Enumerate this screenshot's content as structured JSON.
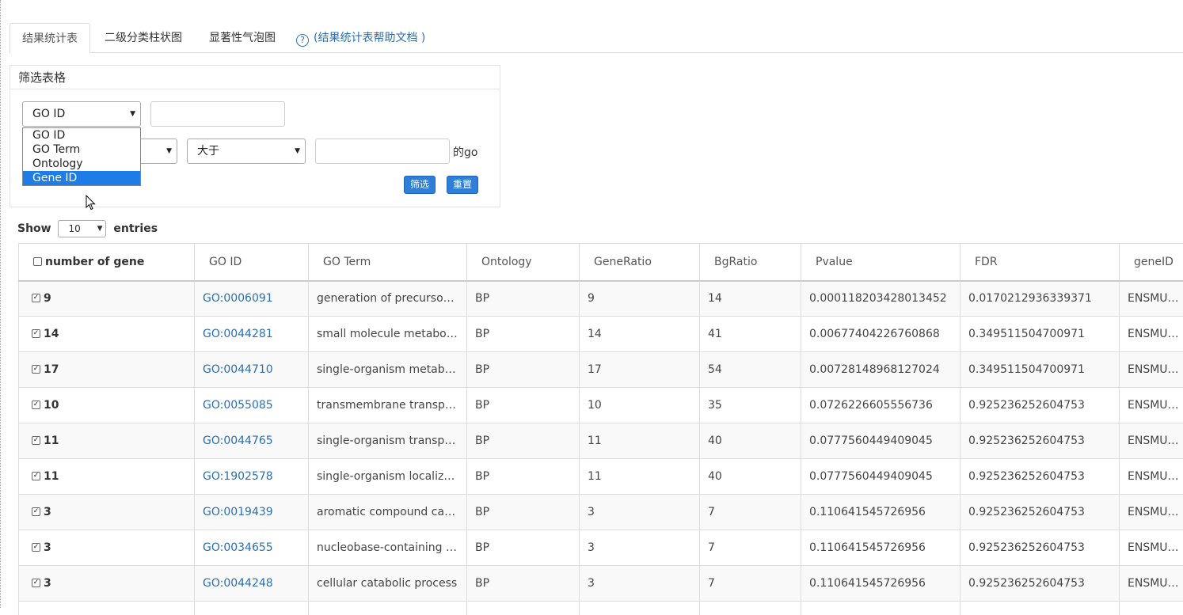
{
  "tabs": [
    {
      "label": "结果统计表",
      "active": true
    },
    {
      "label": "二级分类柱状图",
      "active": false
    },
    {
      "label": "显著性气泡图",
      "active": false
    }
  ],
  "help": {
    "icon": "question-circle-icon",
    "label": "(结果统计表帮助文档 )"
  },
  "filter": {
    "title": "筛选表格",
    "field_select": {
      "value": "GO ID"
    },
    "field_input": {
      "value": ""
    },
    "comparator_select": {
      "value": "大于"
    },
    "value_input": {
      "value": ""
    },
    "suffix": "的go",
    "filter_button": "筛选",
    "reset_button": "重置",
    "dropdown_options": [
      "GO ID",
      "GO Term",
      "Ontology",
      "Gene ID"
    ],
    "dropdown_highlighted": "Gene ID"
  },
  "length_menu": {
    "show": "Show",
    "value": "10",
    "entries": "entries"
  },
  "table": {
    "columns": [
      "number of gene",
      "GO ID",
      "GO Term",
      "Ontology",
      "GeneRatio",
      "BgRatio",
      "Pvalue",
      "FDR",
      "geneID"
    ],
    "rows": [
      {
        "n": "9",
        "go_id": "GO:0006091",
        "term": "generation of precursor ...",
        "ont": "BP",
        "gr": "9",
        "bg": "14",
        "p": "0.000118203428013452",
        "fdr": "0.0170212936339371",
        "gene": "ENSMUSG"
      },
      {
        "n": "14",
        "go_id": "GO:0044281",
        "term": "small molecule metaboli...",
        "ont": "BP",
        "gr": "14",
        "bg": "41",
        "p": "0.00677404226760868",
        "fdr": "0.349511504700971",
        "gene": "ENSMUSG"
      },
      {
        "n": "17",
        "go_id": "GO:0044710",
        "term": "single-organism metabo...",
        "ont": "BP",
        "gr": "17",
        "bg": "54",
        "p": "0.00728148968127024",
        "fdr": "0.349511504700971",
        "gene": "ENSMUSG"
      },
      {
        "n": "10",
        "go_id": "GO:0055085",
        "term": "transmembrane transport",
        "ont": "BP",
        "gr": "10",
        "bg": "35",
        "p": "0.0726226605556736",
        "fdr": "0.925236252604753",
        "gene": "ENSMUSG"
      },
      {
        "n": "11",
        "go_id": "GO:0044765",
        "term": "single-organism transport",
        "ont": "BP",
        "gr": "11",
        "bg": "40",
        "p": "0.0777560449409045",
        "fdr": "0.925236252604753",
        "gene": "ENSMUSG"
      },
      {
        "n": "11",
        "go_id": "GO:1902578",
        "term": "single-organism localizat...",
        "ont": "BP",
        "gr": "11",
        "bg": "40",
        "p": "0.0777560449409045",
        "fdr": "0.925236252604753",
        "gene": "ENSMUSG"
      },
      {
        "n": "3",
        "go_id": "GO:0019439",
        "term": "aromatic compound cata...",
        "ont": "BP",
        "gr": "3",
        "bg": "7",
        "p": "0.110641545726956",
        "fdr": "0.925236252604753",
        "gene": "ENSMUSG"
      },
      {
        "n": "3",
        "go_id": "GO:0034655",
        "term": "nucleobase-containing c...",
        "ont": "BP",
        "gr": "3",
        "bg": "7",
        "p": "0.110641545726956",
        "fdr": "0.925236252604753",
        "gene": "ENSMUSG"
      },
      {
        "n": "3",
        "go_id": "GO:0044248",
        "term": "cellular catabolic process",
        "ont": "BP",
        "gr": "3",
        "bg": "7",
        "p": "0.110641545726956",
        "fdr": "0.925236252604753",
        "gene": "ENSMUSG"
      },
      {
        "n": "",
        "go_id": "",
        "term": "",
        "ont": "",
        "gr": "",
        "bg": "",
        "p": "",
        "fdr": "",
        "gene": ""
      }
    ]
  },
  "colors": {
    "link": "#2a6fb4",
    "button": "#2f7ed8",
    "dropdown_highlight": "#1e7ce6"
  }
}
